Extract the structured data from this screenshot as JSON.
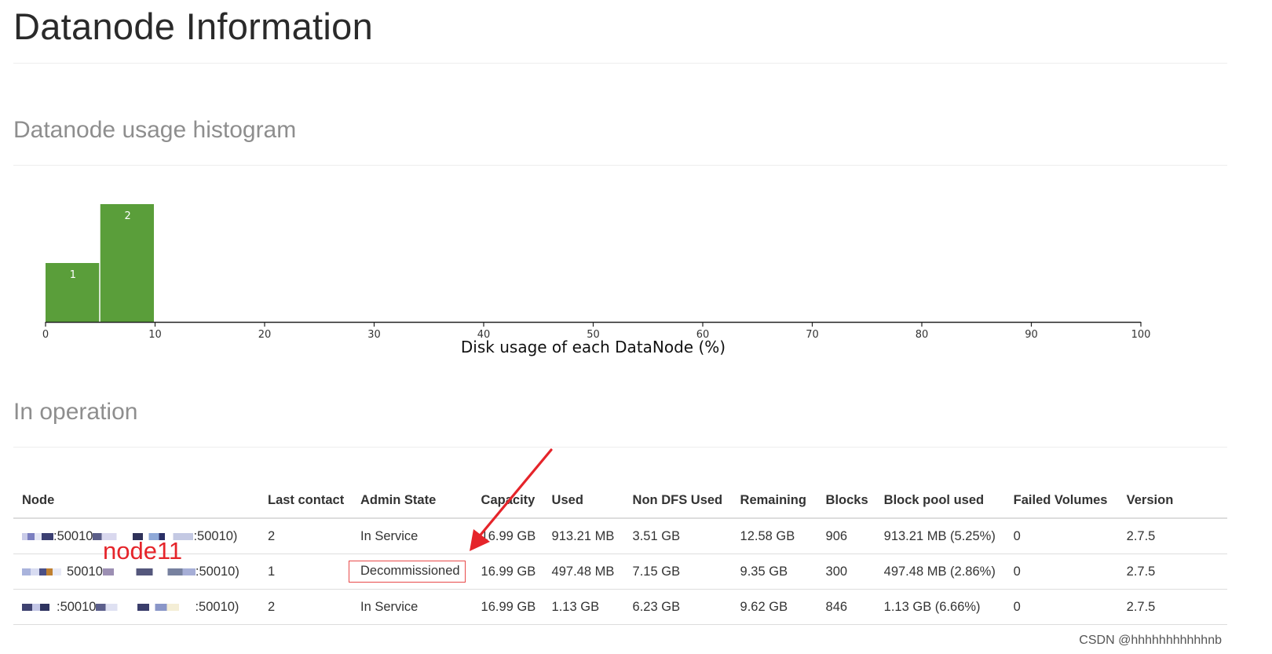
{
  "page": {
    "title": "Datanode Information",
    "histogram_heading": "Datanode usage histogram",
    "operation_heading": "In operation"
  },
  "chart_data": {
    "type": "bar",
    "xlabel": "Disk usage of each DataNode (%)",
    "xlim": [
      0,
      100
    ],
    "x_ticks": [
      0,
      10,
      20,
      30,
      40,
      50,
      60,
      70,
      80,
      90,
      100
    ],
    "bins": [
      {
        "from": 0,
        "to": 5,
        "value": 1
      },
      {
        "from": 5,
        "to": 10,
        "value": 2
      }
    ],
    "bar_color": "#5a9e3a"
  },
  "table": {
    "columns": [
      "Node",
      "Last contact",
      "Admin State",
      "Capacity",
      "Used",
      "Non DFS Used",
      "Remaining",
      "Blocks",
      "Block pool used",
      "Failed Volumes",
      "Version"
    ],
    "rows": [
      {
        "node_a": ":50010",
        "node_b": ":50010)",
        "last_contact": "2",
        "admin_state": "In Service",
        "capacity": "16.99 GB",
        "used": "913.21 MB",
        "non_dfs_used": "3.51 GB",
        "remaining": "12.58 GB",
        "blocks": "906",
        "block_pool_used": "913.21 MB (5.25%)",
        "failed_volumes": "0",
        "version": "2.7.5"
      },
      {
        "node_a": "50010",
        "node_b": ":50010)",
        "last_contact": "1",
        "admin_state": "Decommissioned",
        "capacity": "16.99 GB",
        "used": "497.48 MB",
        "non_dfs_used": "7.15 GB",
        "remaining": "9.35 GB",
        "blocks": "300",
        "block_pool_used": "497.48 MB (2.86%)",
        "failed_volumes": "0",
        "version": "2.7.5"
      },
      {
        "node_a": ":50010",
        "node_b": ":50010)",
        "last_contact": "2",
        "admin_state": "In Service",
        "capacity": "16.99 GB",
        "used": "1.13 GB",
        "non_dfs_used": "6.23 GB",
        "remaining": "9.62 GB",
        "blocks": "846",
        "block_pool_used": "1.13 GB (6.66%)",
        "failed_volumes": "0",
        "version": "2.7.5"
      }
    ]
  },
  "annotation": {
    "label": "node11",
    "color": "#e5242a"
  },
  "watermark": "CSDN @hhhhhhhhhhhnb"
}
